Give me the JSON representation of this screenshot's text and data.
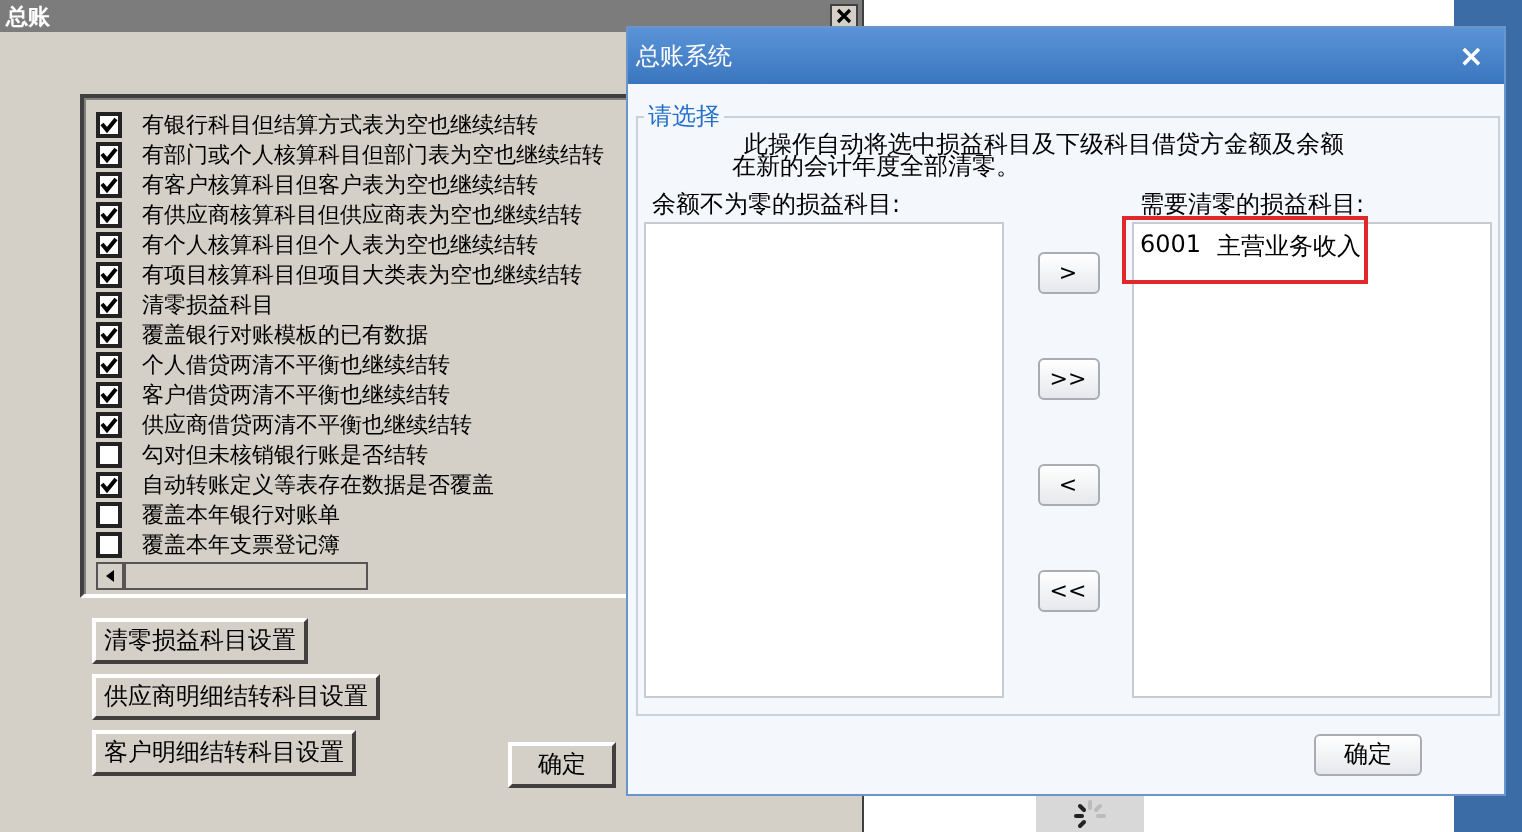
{
  "main_window": {
    "title": "总账",
    "options": [
      {
        "label": "有银行科目但结算方式表为空也继续结转",
        "checked": true
      },
      {
        "label": "有部门或个人核算科目但部门表为空也继续结转",
        "checked": true
      },
      {
        "label": "有客户核算科目但客户表为空也继续结转",
        "checked": true
      },
      {
        "label": "有供应商核算科目但供应商表为空也继续结转",
        "checked": true
      },
      {
        "label": "有个人核算科目但个人表为空也继续结转",
        "checked": true
      },
      {
        "label": "有项目核算科目但项目大类表为空也继续结转",
        "checked": true
      },
      {
        "label": "清零损益科目",
        "checked": true
      },
      {
        "label": "覆盖银行对账模板的已有数据",
        "checked": true
      },
      {
        "label": "个人借贷两清不平衡也继续结转",
        "checked": true
      },
      {
        "label": "客户借贷两清不平衡也继续结转",
        "checked": true
      },
      {
        "label": "供应商借贷两清不平衡也继续结转",
        "checked": true
      },
      {
        "label": "勾对但未核销银行账是否结转",
        "checked": false
      },
      {
        "label": "自动转账定义等表存在数据是否覆盖",
        "checked": true
      },
      {
        "label": "覆盖本年银行对账单",
        "checked": false
      },
      {
        "label": "覆盖本年支票登记簿",
        "checked": false
      }
    ],
    "setting_buttons": [
      "清零损益科目设置",
      "供应商明细结转科目设置",
      "客户明细结转科目设置"
    ],
    "ok_button": "确定"
  },
  "dialog": {
    "title": "总账系统",
    "close": "×",
    "group_label": "请选择",
    "description": [
      "此操作自动将选中损益科目及下级科目借贷方金额及余额",
      "在新的会计年度全部清零。"
    ],
    "source_label": "余额不为零的损益科目:",
    "target_label": "需要清零的损益科目:",
    "target_items": [
      {
        "code": "6001",
        "name": "主营业务收入",
        "highlighted": true
      }
    ],
    "move_buttons": [
      ">",
      ">>",
      "<",
      "<<"
    ],
    "ok_button": "确定"
  }
}
